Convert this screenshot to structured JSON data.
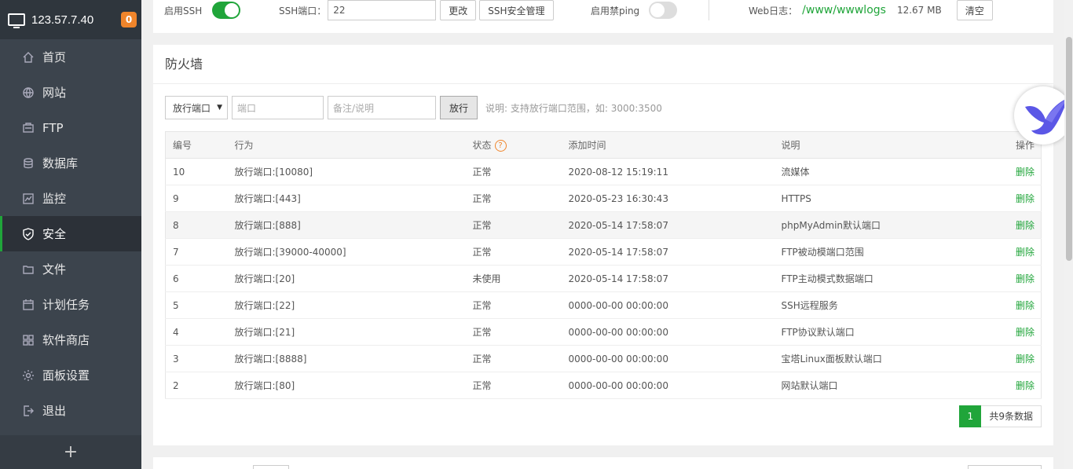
{
  "sidebar": {
    "ip": "123.57.7.40",
    "badge": "0",
    "items": [
      {
        "label": "首页"
      },
      {
        "label": "网站"
      },
      {
        "label": "FTP"
      },
      {
        "label": "数据库"
      },
      {
        "label": "监控"
      },
      {
        "label": "安全"
      },
      {
        "label": "文件"
      },
      {
        "label": "计划任务"
      },
      {
        "label": "软件商店"
      },
      {
        "label": "面板设置"
      },
      {
        "label": "退出"
      }
    ],
    "add_label": "+"
  },
  "top": {
    "ssh_label": "启用SSH",
    "ssh_enabled": true,
    "ssh_port_label": "SSH端口：",
    "ssh_port_value": "22",
    "change_btn": "更改",
    "ssh_manage_btn": "SSH安全管理",
    "ping_label": "启用禁ping",
    "ping_enabled": false,
    "weblog_label": "Web日志：",
    "weblog_path": "/www/wwwlogs",
    "weblog_size": "12.67 MB",
    "clear_btn": "清空"
  },
  "firewall": {
    "title": "防火墙",
    "select_value": "放行端口",
    "port_placeholder": "端口",
    "note_placeholder": "备注/说明",
    "allow_btn": "放行",
    "hint": "说明: 支持放行端口范围，如: 3000:3500",
    "columns": [
      "编号",
      "行为",
      "状态",
      "添加时间",
      "说明",
      "操作"
    ],
    "rows": [
      {
        "id": "10",
        "action": "放行端口:[10080]",
        "status": "正常",
        "time": "2020-08-12 15:19:11",
        "note": "流媒体",
        "op": "删除"
      },
      {
        "id": "9",
        "action": "放行端口:[443]",
        "status": "正常",
        "time": "2020-05-23 16:30:43",
        "note": "HTTPS",
        "op": "删除"
      },
      {
        "id": "8",
        "action": "放行端口:[888]",
        "status": "正常",
        "time": "2020-05-14 17:58:07",
        "note": "phpMyAdmin默认端口",
        "op": "删除"
      },
      {
        "id": "7",
        "action": "放行端口:[39000-40000]",
        "status": "正常",
        "time": "2020-05-14 17:58:07",
        "note": "FTP被动模端口范围",
        "op": "删除"
      },
      {
        "id": "6",
        "action": "放行端口:[20]",
        "status": "未使用",
        "time": "2020-05-14 17:58:07",
        "note": "FTP主动模式数据端口",
        "op": "删除"
      },
      {
        "id": "5",
        "action": "放行端口:[22]",
        "status": "正常",
        "time": "0000-00-00 00:00:00",
        "note": "SSH远程服务",
        "op": "删除"
      },
      {
        "id": "4",
        "action": "放行端口:[21]",
        "status": "正常",
        "time": "0000-00-00 00:00:00",
        "note": "FTP协议默认端口",
        "op": "删除"
      },
      {
        "id": "3",
        "action": "放行端口:[8888]",
        "status": "正常",
        "time": "0000-00-00 00:00:00",
        "note": "宝塔Linux面板默认端口",
        "op": "删除"
      },
      {
        "id": "2",
        "action": "放行端口:[80]",
        "status": "正常",
        "time": "0000-00-00 00:00:00",
        "note": "网站默认端口",
        "op": "删除"
      }
    ],
    "page": "1",
    "total": "共9条数据"
  },
  "colors": {
    "accent": "#20a53a",
    "sidebar": "#3c444d",
    "badge": "#f0852b"
  }
}
